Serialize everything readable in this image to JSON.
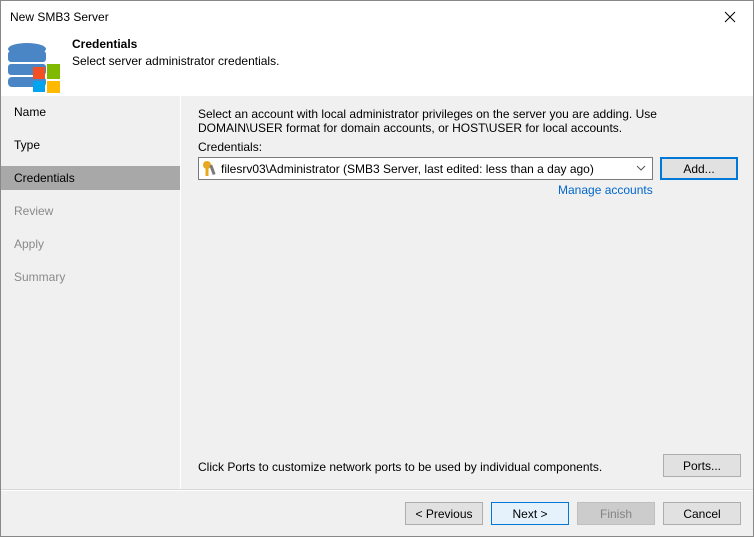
{
  "window": {
    "title": "New SMB3 Server"
  },
  "header": {
    "title": "Credentials",
    "subtitle": "Select server administrator credentials."
  },
  "nav": {
    "items": [
      {
        "label": "Name",
        "state": "done"
      },
      {
        "label": "Type",
        "state": "done"
      },
      {
        "label": "Credentials",
        "state": "active"
      },
      {
        "label": "Review",
        "state": "disabled"
      },
      {
        "label": "Apply",
        "state": "disabled"
      },
      {
        "label": "Summary",
        "state": "disabled"
      }
    ]
  },
  "main": {
    "description": "Select an account with local administrator privileges on the server you are adding. Use DOMAIN\\USER format for domain accounts, or HOST\\USER for local accounts.",
    "credentials_label": "Credentials:",
    "credentials_value": "filesrv03\\Administrator (SMB3 Server, last edited: less than a day ago)",
    "add_label": "Add...",
    "manage_accounts_label": "Manage accounts",
    "ports_text": "Click Ports to customize network ports to be used by individual components.",
    "ports_label": "Ports..."
  },
  "footer": {
    "previous": "< Previous",
    "next": "Next >",
    "finish": "Finish",
    "cancel": "Cancel"
  },
  "colors": {
    "accent": "#0078d7",
    "link": "#0066cc",
    "nav_active": "#a8a8a8"
  }
}
